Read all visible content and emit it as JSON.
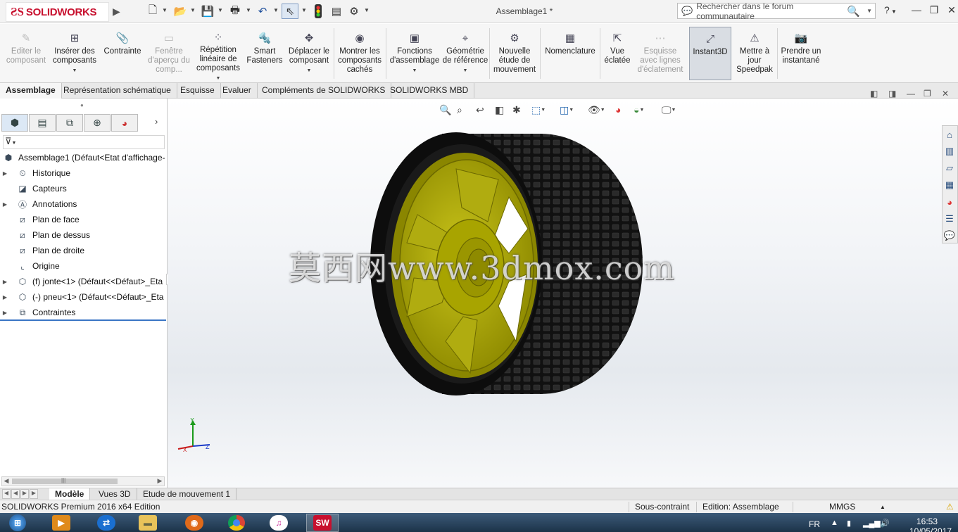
{
  "app": {
    "brand": "SOLIDWORKS",
    "document_title": "Assemblage1 *",
    "search_placeholder": "Rechercher dans le forum communautaire",
    "help_label": "?",
    "window_controls": [
      "minimize",
      "restore",
      "close"
    ]
  },
  "quick_access": {
    "icons": [
      "new-document-icon",
      "open-icon",
      "save-icon",
      "print-icon",
      "undo-icon",
      "select-icon",
      "rebuild-icon",
      "file-properties-icon",
      "options-icon"
    ]
  },
  "ribbon": {
    "buttons": [
      {
        "label": "Editer le composant",
        "icon": "edit-component-icon",
        "disabled": true
      },
      {
        "label": "Insérer des composants",
        "icon": "insert-components-icon",
        "dropdown": true
      },
      {
        "label": "Contrainte",
        "icon": "mate-icon"
      },
      {
        "label": "Fenêtre d'aperçu du comp...",
        "icon": "preview-window-icon",
        "disabled": true
      },
      {
        "label": "Répétition linéaire de composants",
        "icon": "linear-pattern-icon",
        "dropdown": true
      },
      {
        "label": "Smart Fasteners",
        "icon": "smart-fasteners-icon"
      },
      {
        "label": "Déplacer le composant",
        "icon": "move-component-icon",
        "dropdown": true
      },
      {
        "label": "Montrer les composants cachés",
        "icon": "show-hidden-icon"
      },
      {
        "label": "Fonctions d'assemblage",
        "icon": "assembly-features-icon",
        "dropdown": true
      },
      {
        "label": "Géométrie de référence",
        "icon": "reference-geometry-icon",
        "dropdown": true
      },
      {
        "label": "Nouvelle étude de mouvement",
        "icon": "motion-study-icon"
      },
      {
        "label": "Nomenclature",
        "icon": "bom-icon"
      },
      {
        "label": "Vue éclatée",
        "icon": "exploded-view-icon"
      },
      {
        "label": "Esquisse avec lignes d'éclatement",
        "icon": "explode-line-sketch-icon",
        "disabled": true
      },
      {
        "label": "Instant3D",
        "icon": "instant3d-icon",
        "selected": true
      },
      {
        "label": "Mettre à jour Speedpak",
        "icon": "speedpak-icon"
      },
      {
        "label": "Prendre un instantané",
        "icon": "snapshot-icon"
      }
    ]
  },
  "command_tabs": [
    "Assemblage",
    "Représentation schématique",
    "Esquisse",
    "Evaluer",
    "Compléments de SOLIDWORKS",
    "SOLIDWORKS MBD"
  ],
  "active_command_tab": "Assemblage",
  "feature_tree": {
    "root": "Assemblage1  (Défaut<Etat d'affichage-",
    "items": [
      {
        "label": "Historique",
        "icon": "history-icon",
        "expandable": true
      },
      {
        "label": "Capteurs",
        "icon": "sensors-icon",
        "expandable": false
      },
      {
        "label": "Annotations",
        "icon": "annotations-icon",
        "expandable": true
      },
      {
        "label": "Plan de face",
        "icon": "plane-icon",
        "expandable": false
      },
      {
        "label": "Plan de dessus",
        "icon": "plane-icon",
        "expandable": false
      },
      {
        "label": "Plan de droite",
        "icon": "plane-icon",
        "expandable": false
      },
      {
        "label": "Origine",
        "icon": "origin-icon",
        "expandable": false
      },
      {
        "label": "(f) jonte<1> (Défaut<<Défaut>_Eta",
        "icon": "part-icon",
        "expandable": true
      },
      {
        "label": "(-) pneu<1> (Défaut<<Défaut>_Eta",
        "icon": "part-icon",
        "expandable": true
      },
      {
        "label": "Contraintes",
        "icon": "mates-icon",
        "expandable": true
      }
    ]
  },
  "panel_tabs": [
    "feature-manager-icon",
    "property-manager-icon",
    "configuration-manager-icon",
    "dimxpert-icon",
    "display-manager-icon"
  ],
  "heads_up_toolbar": [
    "zoom-to-fit-icon",
    "zoom-area-icon",
    "previous-view-icon",
    "section-view-icon",
    "dynamic-annotation-icon",
    "view-orientation-icon",
    "display-style-icon",
    "hide-show-icon",
    "edit-appearance-icon",
    "apply-scene-icon",
    "view-settings-icon"
  ],
  "task_pane": [
    "home-icon",
    "design-library-icon",
    "file-explorer-icon",
    "view-palette-icon",
    "appearances-icon",
    "custom-properties-icon",
    "forum-icon"
  ],
  "watermark": "莫西网www.3dmox.com",
  "triad_axes": [
    "Y",
    "X",
    "Z"
  ],
  "model_tabs": [
    "Modèle",
    "Vues 3D",
    "Etude de mouvement 1"
  ],
  "active_model_tab": "Modèle",
  "status_bar": {
    "product": "SOLIDWORKS Premium 2016 x64 Edition",
    "constraint": "Sous-contraint",
    "edition": "Edition: Assemblage",
    "units": "MMGS"
  },
  "taskbar": {
    "apps": [
      "start-icon",
      "media-player-icon",
      "teamviewer-icon",
      "file-explorer-icon",
      "firefox-icon",
      "chrome-icon",
      "itunes-icon",
      "solidworks-icon"
    ],
    "language": "FR",
    "time": "16:53",
    "date": "10/05/2017"
  },
  "colors": {
    "rim": "#b8b400",
    "tire": "#1a1a1a",
    "brand_red": "#c8102e",
    "selection_blue": "#3a75c4"
  }
}
